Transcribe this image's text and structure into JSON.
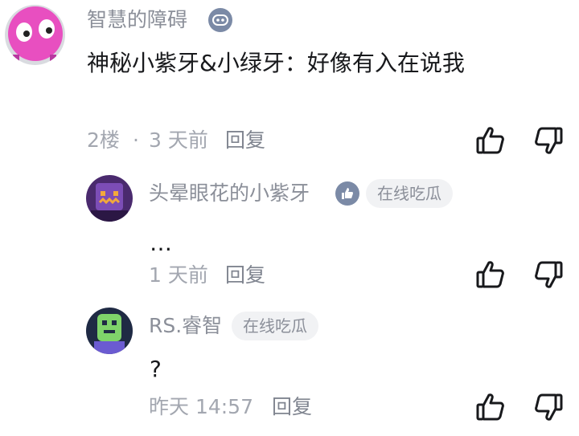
{
  "comments": [
    {
      "name": "智慧的障碍",
      "badge_icon": "gamepad-icon",
      "content": "神秘小紫牙&小绿牙：好像有入在说我",
      "floor": "2楼",
      "separator": "·",
      "time": "3 天前",
      "reply_label": "回复"
    }
  ],
  "replies": [
    {
      "name": "头晕眼花的小紫牙",
      "badge_icon": "thumbs-up-badge-icon",
      "tag": "在线吃瓜",
      "content": "…",
      "time": "1 天前",
      "reply_label": "回复"
    },
    {
      "name": "RS.睿智",
      "tag": "在线吃瓜",
      "content": "?",
      "time": "昨天 14:57",
      "reply_label": "回复"
    }
  ],
  "colors": {
    "name": "#8b8f99",
    "content": "#18191c",
    "meta": "#a3a7b0",
    "tag_bg": "#f1f2f4",
    "icon": "#18191c"
  }
}
